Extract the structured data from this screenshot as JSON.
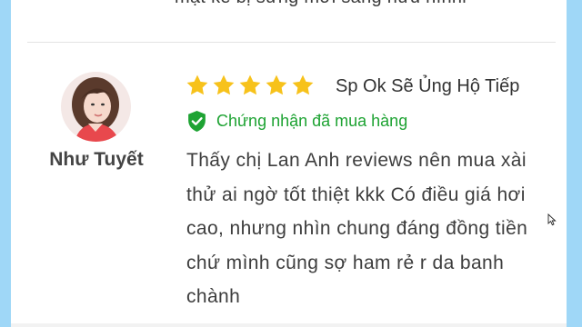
{
  "previous_review": {
    "text": "mặt kê bị sưng mới sáng hưu hìnhl"
  },
  "review": {
    "reviewer_name": "Như Tuyết",
    "rating": 5,
    "rating_max": 5,
    "title": "Sp Ok Sẽ Ủng Hộ Tiếp",
    "verified_label": "Chứng nhận đã mua hàng",
    "body": "Thấy chị Lan Anh reviews nên mua xài thử ai ngờ tốt thiệt kkk Có điều giá hơi cao, nhưng nhìn chung đáng đồng tiền chứ mình cũng sợ ham rẻ r da banh chành"
  },
  "colors": {
    "star": "#f7c21b",
    "verified": "#1ea333",
    "side_border": "#9fd7f7"
  },
  "icons": {
    "star": "star-icon",
    "verified": "shield-check-icon",
    "cursor": "mouse-cursor-icon"
  }
}
